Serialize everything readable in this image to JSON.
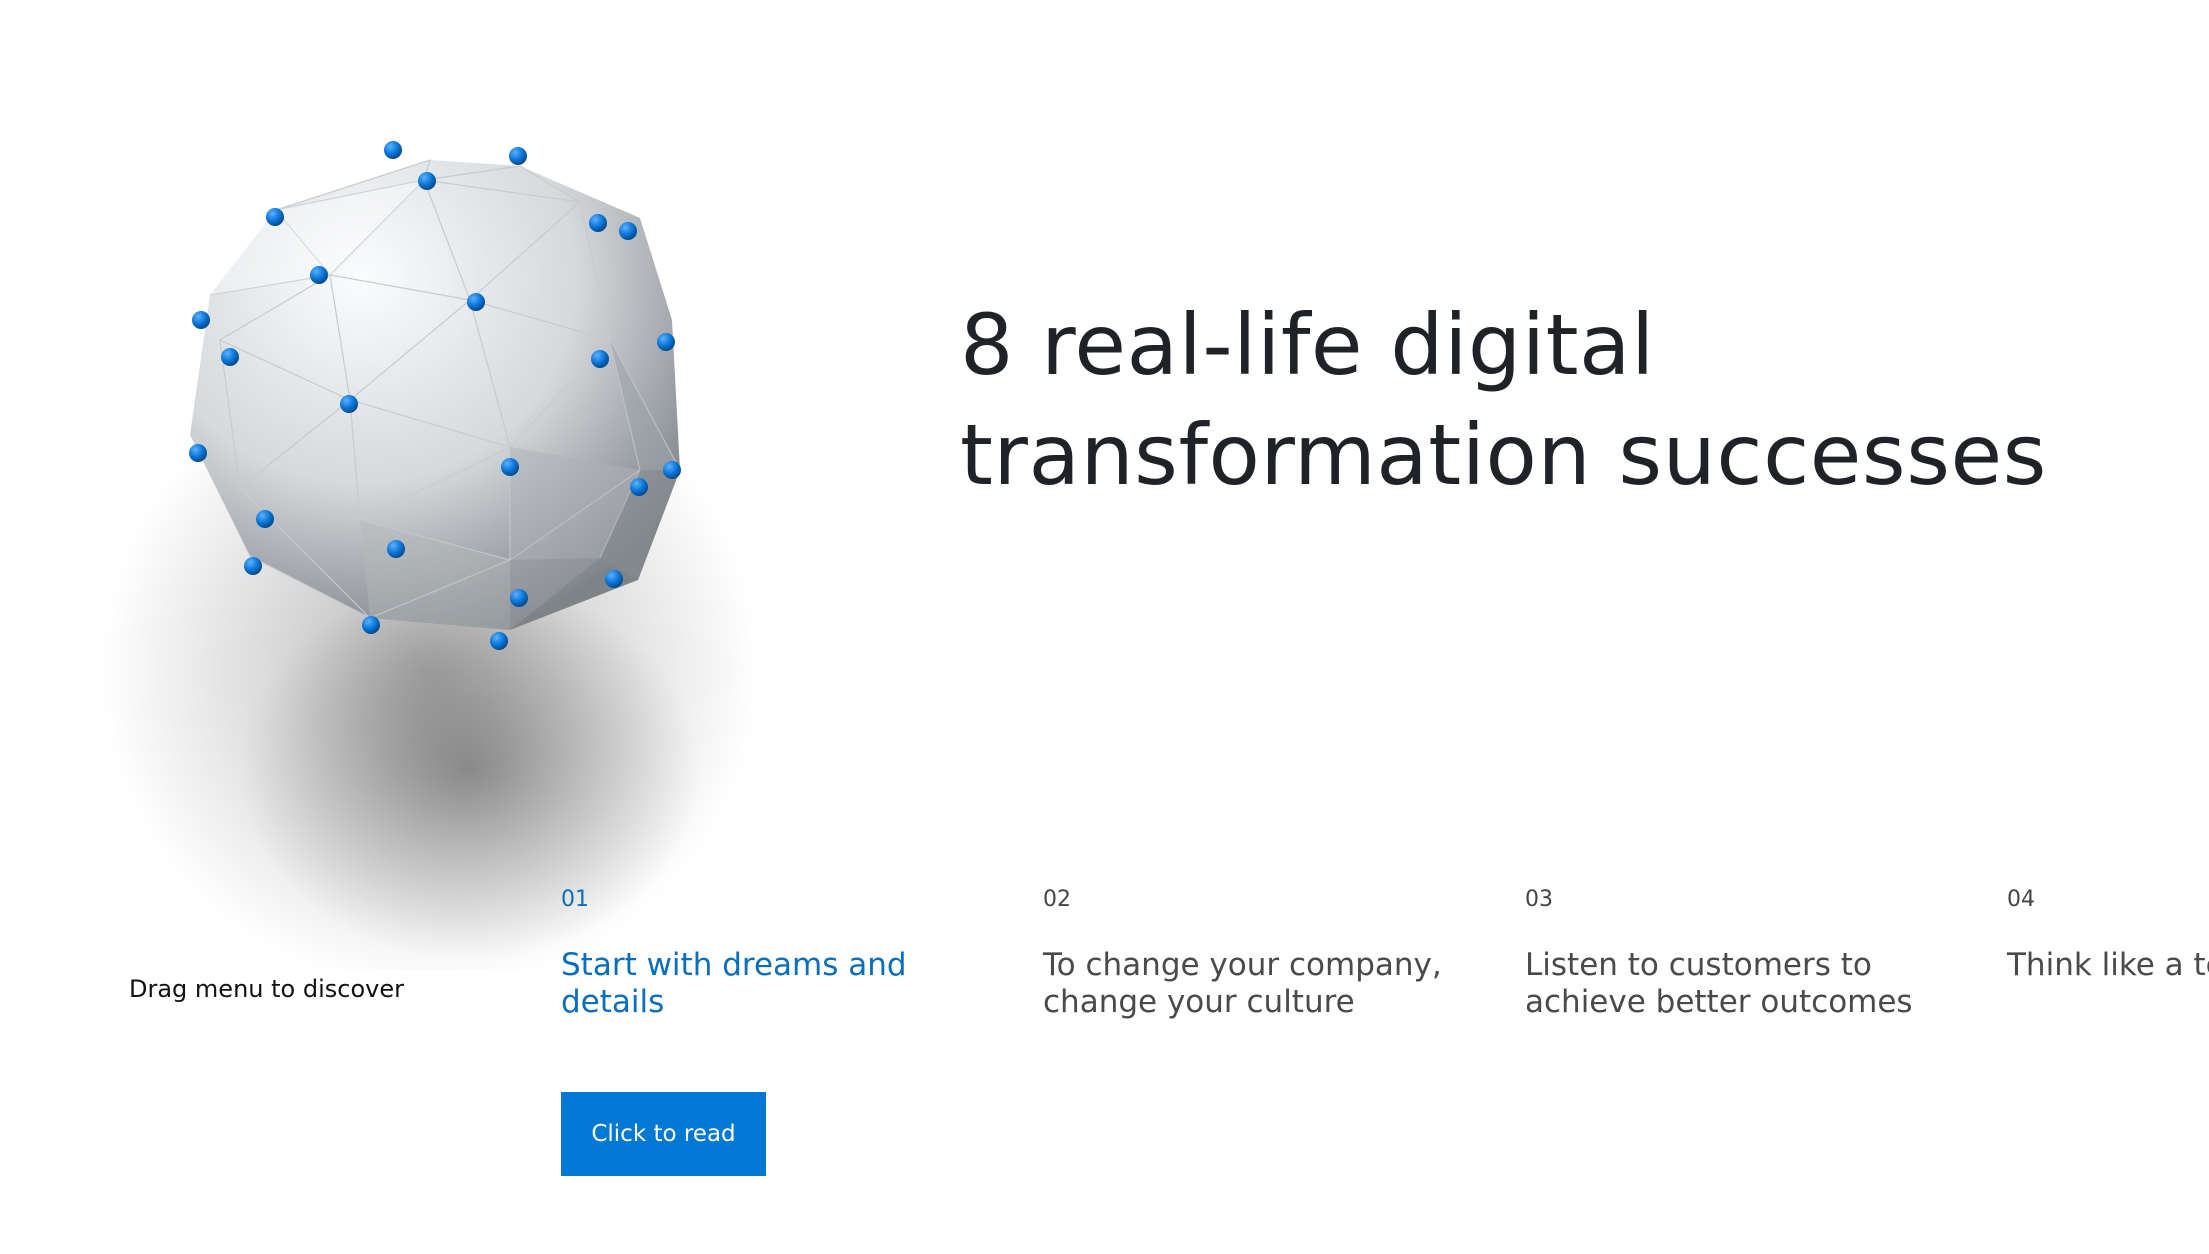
{
  "hero": {
    "headline_line1": "8 real-life digital",
    "headline_line2": "transformation successes",
    "graphic_icon": "polyhedron-sphere-icon"
  },
  "carousel": {
    "hint": "Drag menu to discover",
    "items": [
      {
        "number": "01",
        "title": "Start with dreams and details",
        "active": true
      },
      {
        "number": "02",
        "title": "To change your company, change your culture",
        "active": false
      },
      {
        "number": "03",
        "title": "Listen to customers to achieve better outcomes",
        "active": false
      },
      {
        "number": "04",
        "title": "Think like a tech company",
        "active": false
      }
    ],
    "cta_label": "Click to read"
  },
  "colors": {
    "accent": "#0078d4",
    "active_text": "#0a6ebd",
    "headline": "#1f2328",
    "node": "#0a74d6"
  }
}
